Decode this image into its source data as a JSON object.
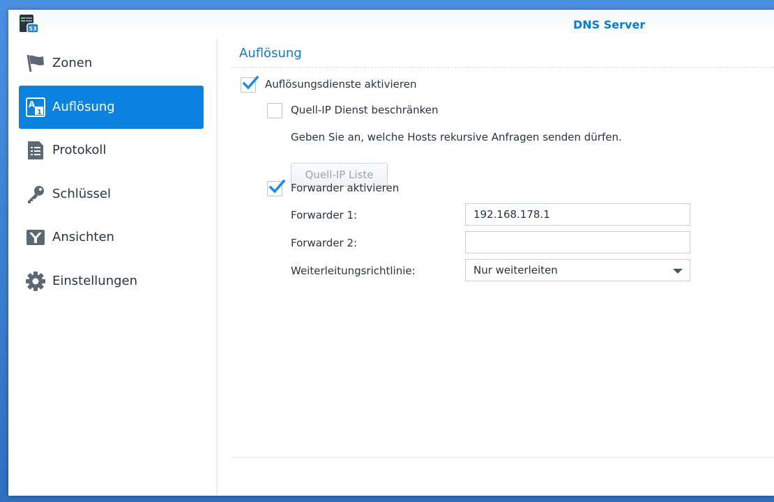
{
  "window": {
    "title": "DNS Server",
    "app_icon": "dns-server-app-icon",
    "app_icon_badge": "53"
  },
  "sidebar": {
    "items": [
      {
        "label": "Zonen",
        "icon": "flag-icon",
        "active": false
      },
      {
        "label": "Auflösung",
        "icon": "resolution-icon",
        "active": true
      },
      {
        "label": "Protokoll",
        "icon": "log-icon",
        "active": false
      },
      {
        "label": "Schlüssel",
        "icon": "key-icon",
        "active": false
      },
      {
        "label": "Ansichten",
        "icon": "views-icon",
        "active": false
      },
      {
        "label": "Einstellungen",
        "icon": "gear-icon",
        "active": false
      }
    ]
  },
  "main": {
    "section_title": "Auflösung",
    "enable_resolution": {
      "label": "Auflösungsdienste aktivieren",
      "checked": true
    },
    "limit_source_ip": {
      "label": "Quell-IP Dienst beschränken",
      "checked": false
    },
    "hint": "Geben Sie an, welche Hosts rekursive Anfragen senden dürfen.",
    "source_ip_list_button": "Quell-IP Liste",
    "enable_forwarder": {
      "label": "Forwarder aktivieren",
      "checked": true
    },
    "forwarder1": {
      "label": "Forwarder 1:",
      "value": "192.168.178.1"
    },
    "forwarder2": {
      "label": "Forwarder 2:",
      "value": ""
    },
    "forward_policy": {
      "label": "Weiterleitungsrichtlinie:",
      "value": "Nur weiterleiten"
    }
  },
  "colors": {
    "accent": "#0b82e0",
    "title_blue": "#0b7ad1",
    "text": "#2a3340",
    "check_blue": "#1a8ae6"
  }
}
